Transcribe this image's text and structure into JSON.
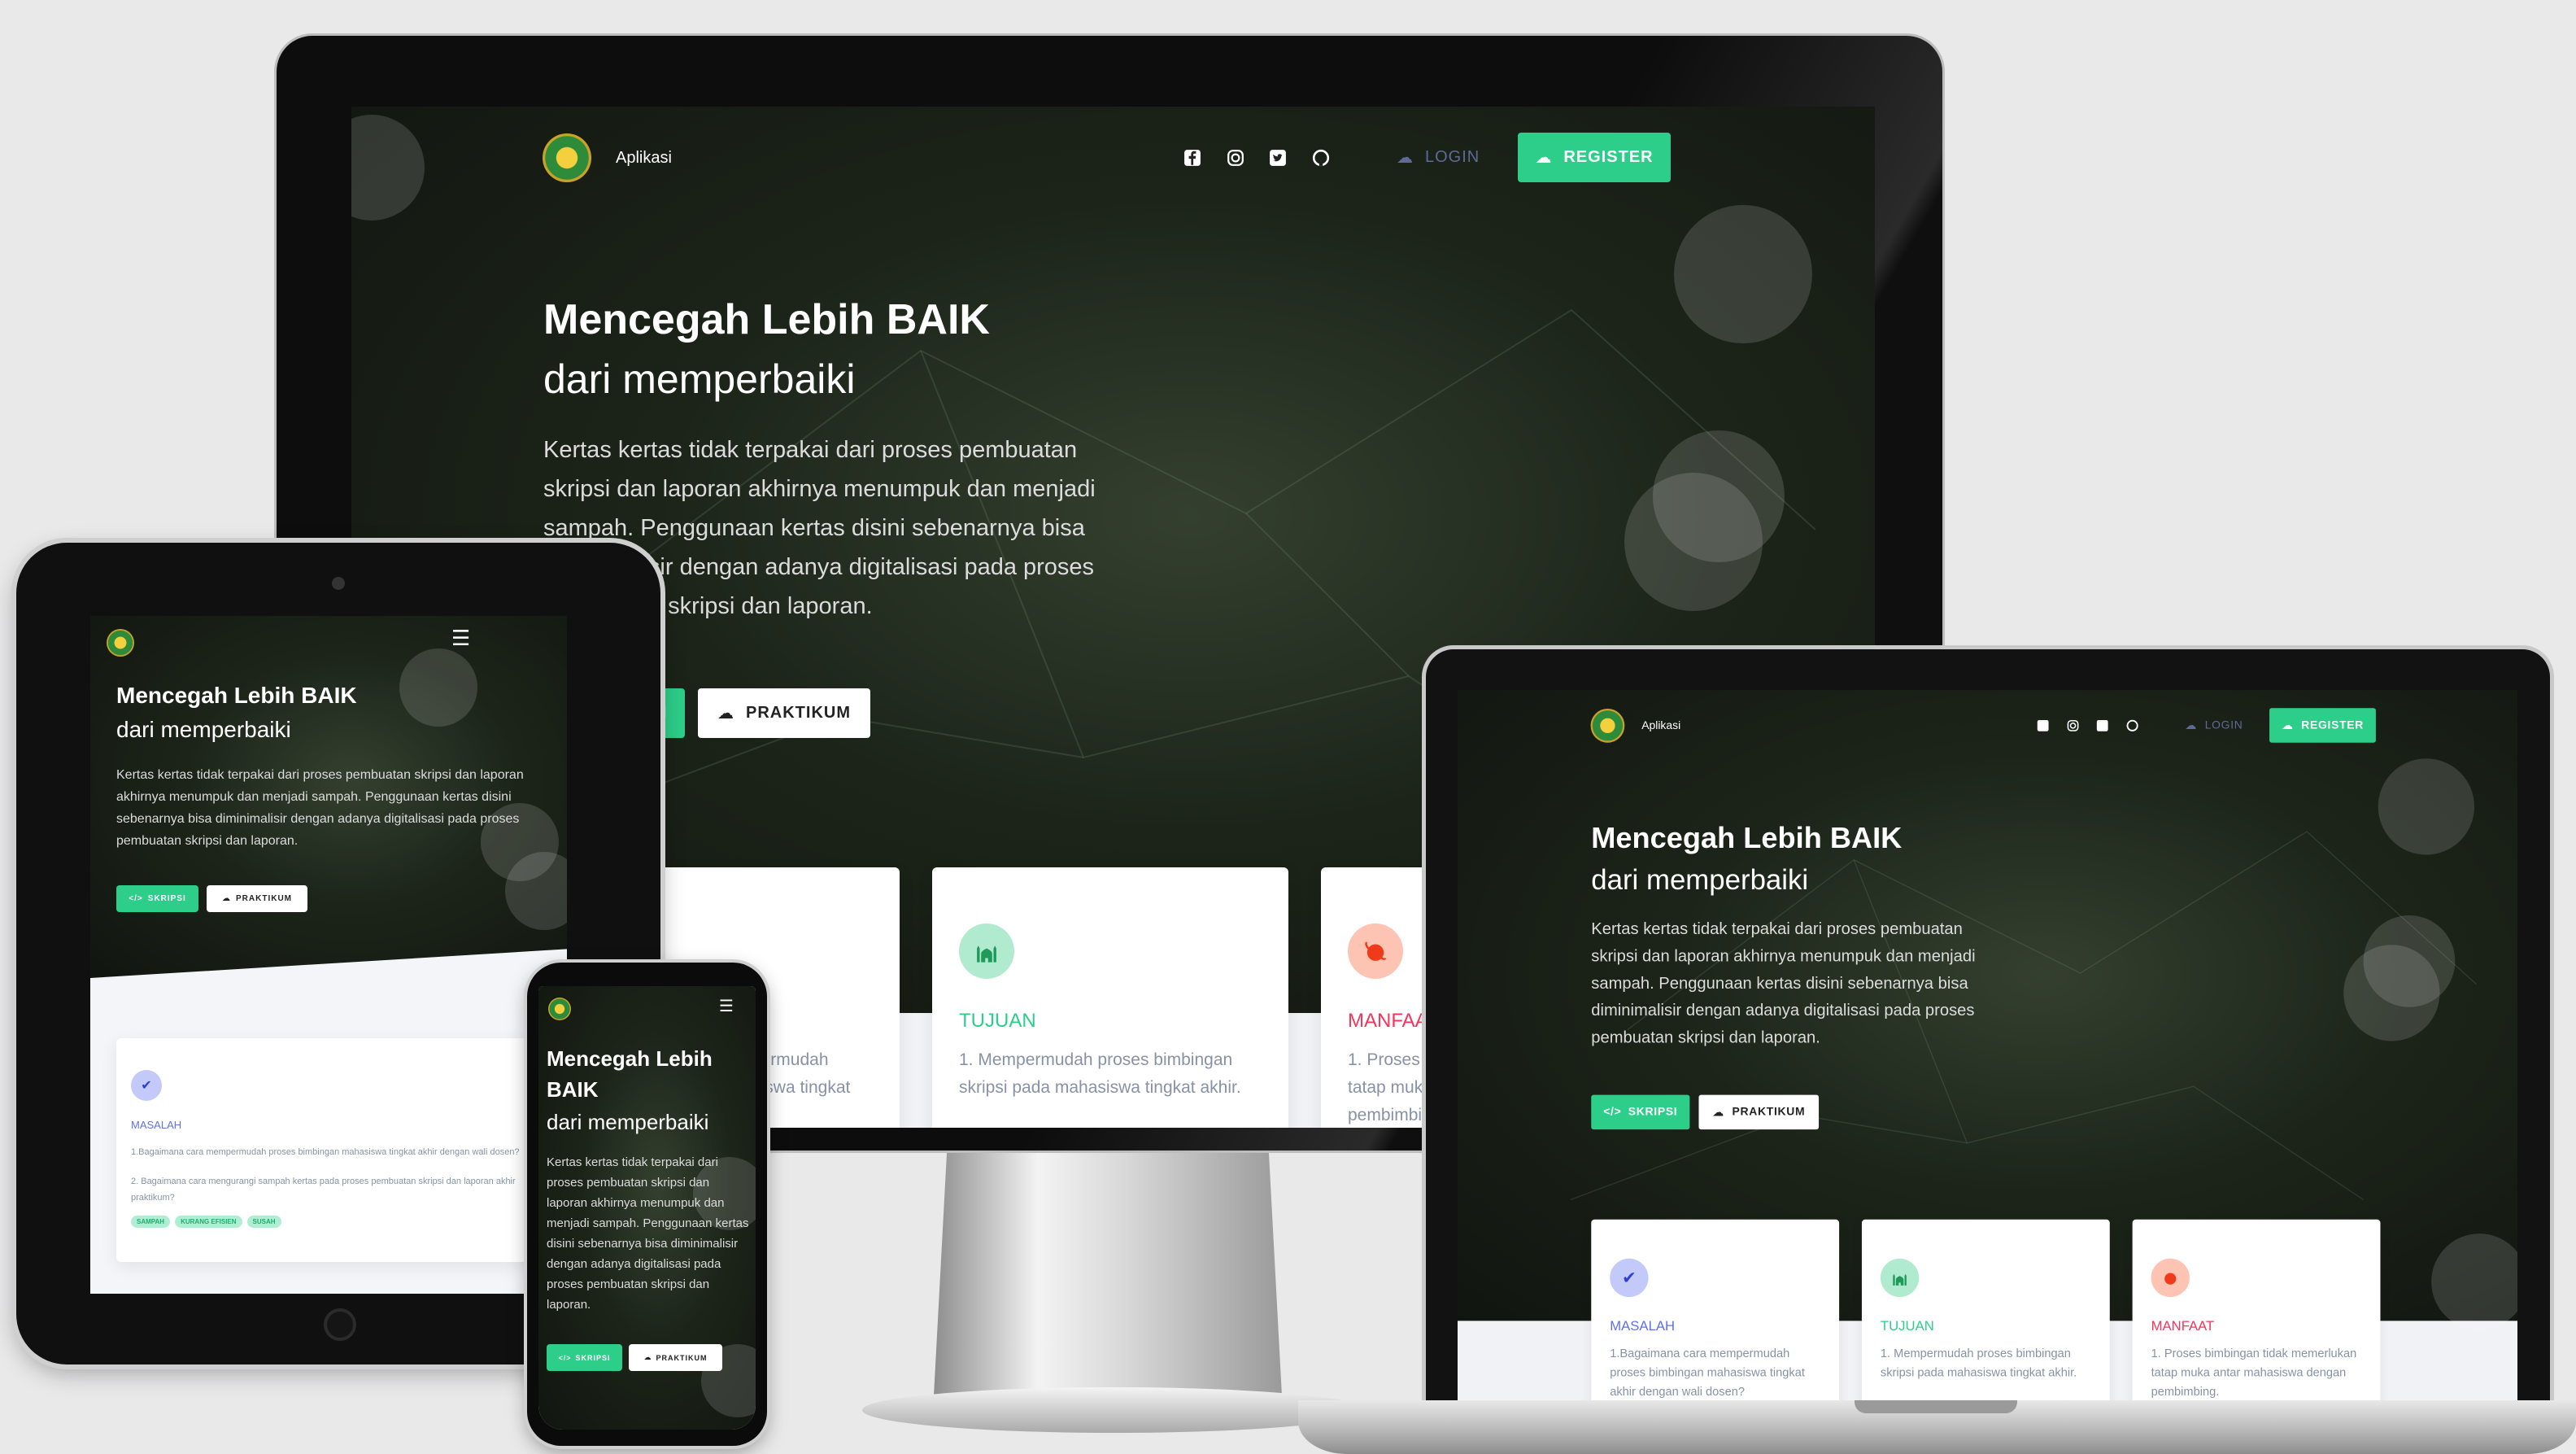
{
  "site": {
    "brand": "Aplikasi",
    "nav": {
      "login": "LOGIN",
      "register": "REGISTER"
    },
    "social_icons": [
      "facebook-icon",
      "instagram-icon",
      "twitter-icon",
      "github-icon"
    ],
    "hero": {
      "title": "Mencegah Lebih BAIK",
      "subtitle": "dari memperbaiki",
      "paragraph": "Kertas kertas tidak terpakai dari proses pembuatan skripsi dan laporan akhirnya menumpuk dan menjadi sampah. Penggunaan kertas disini sebenarnya bisa diminimalisir dengan adanya digitalisasi pada proses pembuatan skripsi dan laporan.",
      "buttons": {
        "skripsi": "SKRIPSI",
        "praktikum": "PRAKTIKUM"
      }
    },
    "cards": [
      {
        "title": "MASALAH",
        "icon": "check-icon",
        "color": "#5e72e4",
        "lines": [
          "1.Bagaimana cara mempermudah proses bimbingan mahasiswa tingkat akhir dengan wali dosen?",
          "2. Bagaimana cara mengurangi sampah kertas pada proses pembuatan skripsi dan laporan akhir praktikum?"
        ],
        "tags": [
          "SAMPAH",
          "KURANG EFISIEN",
          "SUSAH"
        ]
      },
      {
        "title": "TUJUAN",
        "icon": "mosque-icon",
        "color": "#2dce89",
        "lines": [
          "1. Mempermudah proses bimbingan skripsi pada mahasiswa tingkat akhir."
        ]
      },
      {
        "title": "MANFAAT",
        "icon": "planet-icon",
        "color": "#f5365c",
        "lines": [
          "1. Proses bimbingan tidak memerlukan tatap muka antar mahasiswa dengan pembimbing."
        ]
      }
    ]
  },
  "colors": {
    "accent": "#2dce89",
    "background": "#e9e9ea",
    "hero": "#1c2419"
  }
}
